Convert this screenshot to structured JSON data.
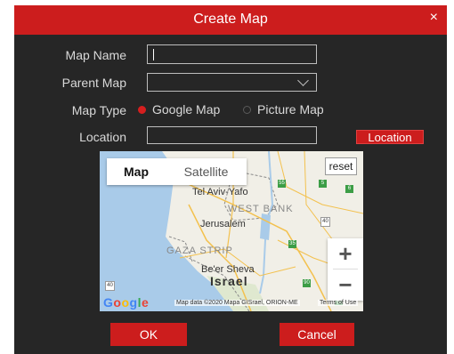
{
  "dialog": {
    "title": "Create Map",
    "close_glyph": "×",
    "colors": {
      "titlebar": "#cc1d1d",
      "background": "#262626",
      "accent": "#cc1d1d"
    }
  },
  "form": {
    "map_name_label": "Map Name",
    "map_name_value": "",
    "parent_map_label": "Parent Map",
    "parent_map_value": "",
    "map_type_label": "Map Type",
    "map_type_options": [
      {
        "label": "Google Map",
        "selected": true
      },
      {
        "label": "Picture Map",
        "selected": false
      }
    ],
    "location_label": "Location",
    "location_value": "",
    "location_button": "Location"
  },
  "map": {
    "tabs": {
      "map": "Map",
      "satellite": "Satellite"
    },
    "reset_label": "reset",
    "zoom_in": "+",
    "zoom_out": "−",
    "labels": {
      "tel_aviv": "Tel Aviv-Yafo",
      "west_bank": "WEST BANK",
      "jerusalem": "Jerusalem",
      "gaza": "GAZA STRIP",
      "beersheva": "Be'er Sheva",
      "israel": "Israel"
    },
    "road_shields": [
      "55",
      "5",
      "6",
      "40",
      "35",
      "40",
      "90",
      "6"
    ],
    "logo": "Google",
    "attribution": "Map data ©2020 Mapa GISrael, ORION-ME",
    "terms": "Terms of Use"
  },
  "footer": {
    "ok_label": "OK",
    "cancel_label": "Cancel"
  }
}
